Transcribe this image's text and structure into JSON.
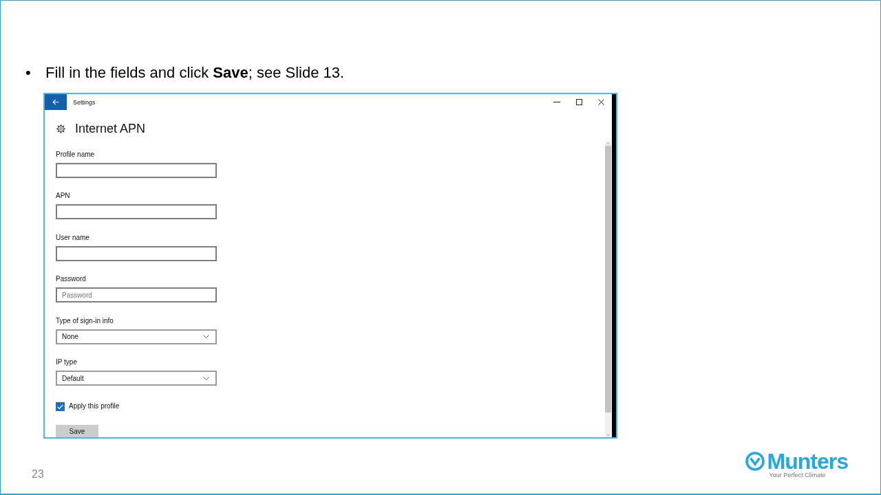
{
  "bullets": [
    {
      "marker": "•",
      "text": "Fill in the fields and click **Save**; see Slide 13."
    }
  ],
  "window": {
    "title": "Settings",
    "heading": "Internet APN",
    "fields": [
      {
        "kind": "input",
        "label": "Profile name"
      },
      {
        "kind": "input",
        "label": "APN"
      },
      {
        "kind": "input",
        "label": "User name"
      },
      {
        "kind": "input",
        "label": "Password",
        "placeholder": "Password"
      },
      {
        "kind": "select",
        "label": "Type of sign-in info",
        "value": "None"
      },
      {
        "kind": "select",
        "label": "IP type",
        "value": "Default"
      }
    ],
    "checkbox": {
      "label": "Apply this profile",
      "checked": true
    },
    "buttons": [
      "Save"
    ]
  },
  "page_number": "23",
  "logo": {
    "name": "Munters",
    "tagline": "Your Perfect Climate"
  }
}
